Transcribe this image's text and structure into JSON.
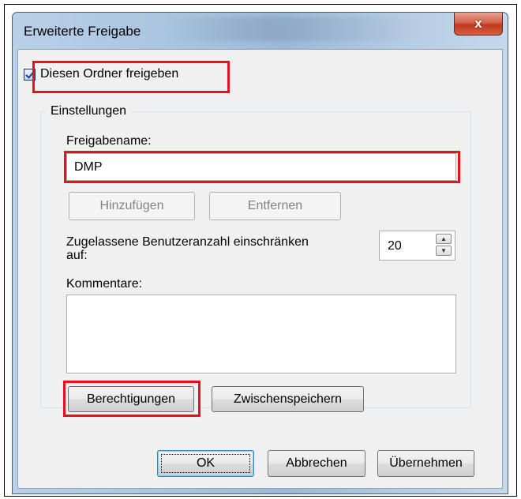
{
  "window": {
    "title": "Erweiterte Freigabe",
    "close_label": "x"
  },
  "share": {
    "checkbox_label": "Diesen Ordner freigeben",
    "checked": true
  },
  "settings": {
    "group_label": "Einstellungen",
    "share_name_label": "Freigabename:",
    "share_name_value": "DMP",
    "add_label": "Hinzufügen",
    "remove_label": "Entfernen",
    "limit_label_line1": "Zugelassene Benutzeranzahl einschränken",
    "limit_label_line2": "auf:",
    "limit_value": "20",
    "spin_up_icon": "▲",
    "spin_down_icon": "▼",
    "comments_label": "Kommentare:",
    "comments_value": "",
    "permissions_label": "Berechtigungen",
    "caching_label": "Zwischenspeichern"
  },
  "footer": {
    "ok_label": "OK",
    "cancel_label": "Abbrechen",
    "apply_label": "Übernehmen"
  },
  "colors": {
    "highlight": "#e8101e",
    "title_bar": "#a9c4df",
    "close_button": "#c0391f"
  }
}
